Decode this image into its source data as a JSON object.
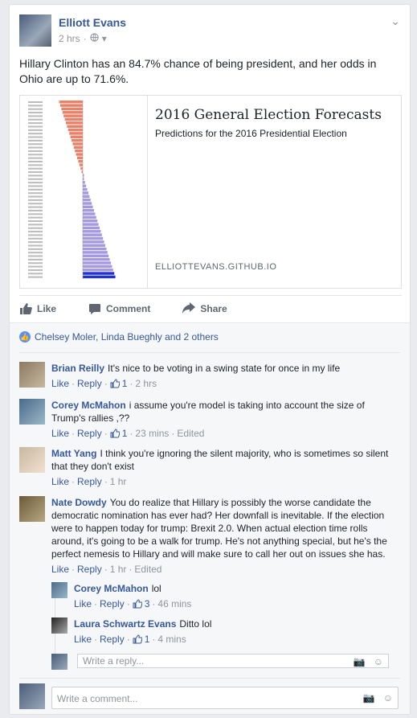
{
  "post": {
    "author": "Elliott Evans",
    "time": "2 hrs",
    "text": "Hillary Clinton has an 84.7% chance of being president, and her odds in Ohio are up to 71.6%."
  },
  "link": {
    "title": "2016 General Election Forecasts",
    "subtitle": "Predictions for the 2016 Presidential Election",
    "domain": "ELLIOTTEVANS.GITHUB.IO"
  },
  "actions": {
    "like": "Like",
    "comment": "Comment",
    "share": "Share"
  },
  "likes_summary": "Chelsey Moler, Linda Bueghly and 2 others",
  "comments": [
    {
      "name": "Brian Reilly",
      "text": "It's nice to be voting in a swing state for once in my life",
      "like": "Like",
      "reply": "Reply",
      "count": "1",
      "time": "2 hrs"
    },
    {
      "name": "Corey McMahon",
      "text": "i assume you're model is taking into account the size of Trump's rallies ,??",
      "like": "Like",
      "reply": "Reply",
      "count": "1",
      "time": "23 mins",
      "edited": "Edited"
    },
    {
      "name": "Matt Yang",
      "text": "I think you're ignoring the silent majority, who is sometimes so silent that they don't exist",
      "like": "Like",
      "reply": "Reply",
      "time": "1 hr"
    },
    {
      "name": "Nate Dowdy",
      "text": "You do realize that Hillary is possibly the worse candidate the democratic nomination has ever had? Her downfall is inevitable. If the election were to happen today for trump: Brexit 2.0. When actual election time rolls around, it's going to be a walk for trump. He's not anything special, but he's the perfect nemesis to Hillary and will make sure to call her out on issues she has.",
      "like": "Like",
      "reply": "Reply",
      "time": "1 hr",
      "edited": "Edited"
    }
  ],
  "replies": [
    {
      "name": "Corey McMahon",
      "text": "lol",
      "like": "Like",
      "reply": "Reply",
      "count": "3",
      "time": "46 mins"
    },
    {
      "name": "Laura Schwartz Evans",
      "text": "Ditto lol",
      "like": "Like",
      "reply": "Reply",
      "count": "1",
      "time": "4 mins"
    }
  ],
  "reply_placeholder": "Write a reply...",
  "comment_placeholder": "Write a comment...",
  "colors": {
    "link": "#365899",
    "muted": "#90949c",
    "accent": "#5890ff"
  },
  "icons": [
    "globe-icon",
    "chevron-down-icon",
    "like-icon",
    "comment-icon",
    "share-icon",
    "camera-icon",
    "emoji-icon"
  ]
}
